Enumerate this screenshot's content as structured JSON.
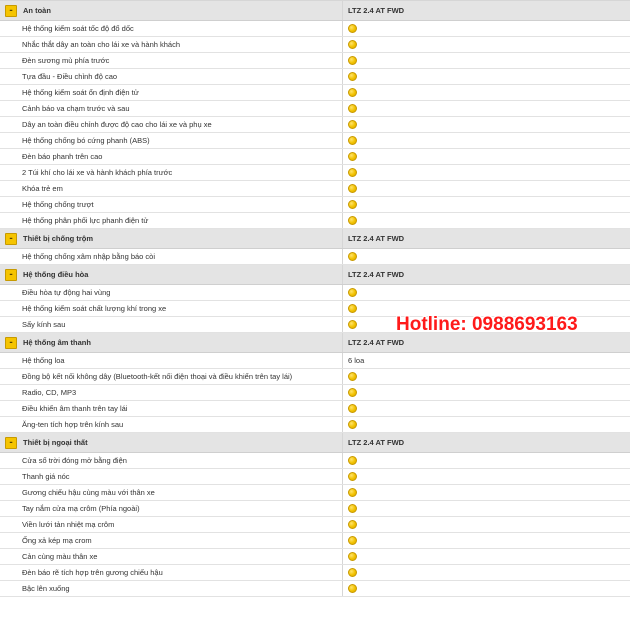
{
  "colors": {
    "header_bg": "#e4e4e4",
    "toggle": "#f5c400",
    "dot": "#f2c200",
    "hotline": "#ff1a1a"
  },
  "icons": {
    "section_toggle": "minus-toggle-icon",
    "feature_available": "yellow-dot-icon"
  },
  "sections": [
    {
      "title": "An toàn",
      "column_label": "LTZ 2.4 AT FWD",
      "toggle_symbol": "-",
      "rows": [
        {
          "label": "Hệ thống kiểm soát tốc độ đổ dốc",
          "value": ""
        },
        {
          "label": "Nhắc thắt dây an toàn cho lái xe và hành khách",
          "value": ""
        },
        {
          "label": "Đèn sương mù phía trước",
          "value": ""
        },
        {
          "label": "Tựa đầu - Điều chỉnh độ cao",
          "value": ""
        },
        {
          "label": "Hệ thống kiểm soát ổn định điện tử",
          "value": ""
        },
        {
          "label": "Cảnh báo va chạm trước và sau",
          "value": ""
        },
        {
          "label": "Dây an toàn điều chỉnh được độ cao cho lái xe và phụ xe",
          "value": ""
        },
        {
          "label": "Hệ thống chống bó cứng phanh (ABS)",
          "value": ""
        },
        {
          "label": "Đèn báo phanh trên cao",
          "value": ""
        },
        {
          "label": "2 Túi khí cho lái xe và hành khách phía trước",
          "value": ""
        },
        {
          "label": "Khóa trẻ em",
          "value": ""
        },
        {
          "label": "Hệ thống chống trượt",
          "value": ""
        },
        {
          "label": "Hệ thống phân phối lực phanh điện tử",
          "value": ""
        }
      ]
    },
    {
      "title": "Thiết bị chống trộm",
      "column_label": "LTZ 2.4 AT FWD",
      "toggle_symbol": "-",
      "rows": [
        {
          "label": "Hệ thống chống xâm nhập bằng báo còi",
          "value": ""
        }
      ]
    },
    {
      "title": "Hệ thống điều hòa",
      "column_label": "LTZ 2.4 AT FWD",
      "toggle_symbol": "-",
      "rows": [
        {
          "label": "Điều hòa tự động hai vùng",
          "value": ""
        },
        {
          "label": "Hệ thống kiểm soát chất lượng khí trong xe",
          "value": ""
        },
        {
          "label": "Sấy kính sau",
          "value": ""
        }
      ]
    },
    {
      "title": "Hệ thống âm thanh",
      "column_label": "LTZ 2.4 AT FWD",
      "toggle_symbol": "-",
      "rows": [
        {
          "label": "Hệ thống loa",
          "value": "6 loa"
        },
        {
          "label": "Đồng bộ kết nối không dây (Bluetooth-kết nối điện thoại và điều khiển trên tay lái)",
          "value": ""
        },
        {
          "label": "Radio, CD, MP3",
          "value": ""
        },
        {
          "label": "Điều khiển âm thanh trên tay lái",
          "value": ""
        },
        {
          "label": "Ăng-ten tích hợp trên kính sau",
          "value": ""
        }
      ]
    },
    {
      "title": "Thiết bị ngoại thất",
      "column_label": "LTZ 2.4 AT FWD",
      "toggle_symbol": "-",
      "rows": [
        {
          "label": "Cửa sổ trời đóng mở bằng điện",
          "value": ""
        },
        {
          "label": "Thanh giá nóc",
          "value": ""
        },
        {
          "label": "Gương chiếu hậu cùng màu với thân xe",
          "value": ""
        },
        {
          "label": "Tay nắm cửa mạ crôm (Phía ngoài)",
          "value": ""
        },
        {
          "label": "Viền lưới tản nhiệt mạ crôm",
          "value": ""
        },
        {
          "label": "Ống xả kép mạ crom",
          "value": ""
        },
        {
          "label": "Cản cùng màu thân xe",
          "value": ""
        },
        {
          "label": "Đèn báo rẽ tích hợp trên gương chiếu hậu",
          "value": ""
        },
        {
          "label": "Bậc lên xuống",
          "value": ""
        }
      ]
    }
  ],
  "overlay": {
    "hotline_text": "Hotline: 0988693163"
  }
}
